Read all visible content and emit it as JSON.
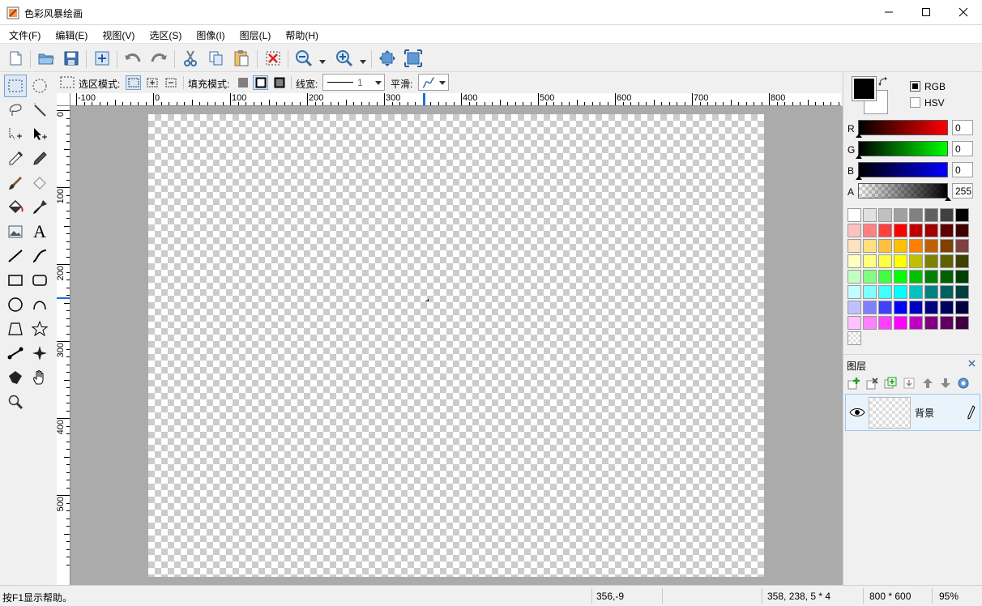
{
  "window": {
    "title": "色彩风暴绘画"
  },
  "menu": [
    "文件(F)",
    "编辑(E)",
    "视图(V)",
    "选区(S)",
    "图像(I)",
    "图层(L)",
    "帮助(H)"
  ],
  "toolbar": {
    "icons": [
      "new-file-icon",
      "open-folder-icon",
      "save-icon",
      "resize-canvas-icon",
      "undo-icon",
      "redo-icon",
      "cut-icon",
      "copy-icon",
      "paste-icon",
      "deselect-icon",
      "zoom-out-icon",
      "zoom-in-icon",
      "fit-window-icon",
      "actual-size-icon"
    ]
  },
  "options": {
    "select_mode_label": "选区模式:",
    "fill_mode_label": "填充模式:",
    "line_width_label": "线宽:",
    "line_width_value": "1",
    "smooth_label": "平滑:"
  },
  "rulers": {
    "horizontal": [
      "-100",
      "0",
      "100",
      "200",
      "300",
      "400",
      "500",
      "600",
      "700",
      "800"
    ],
    "vertical": [
      "0",
      "100",
      "200",
      "300",
      "400",
      "500"
    ]
  },
  "color": {
    "primary": "#000000",
    "secondary": "#ffffff",
    "mode_rgb": "RGB",
    "mode_hsv": "HSV",
    "r_label": "R",
    "r_value": "0",
    "g_label": "G",
    "g_value": "0",
    "b_label": "B",
    "b_value": "0",
    "a_label": "A",
    "a_value": "255",
    "palette": [
      [
        "#ffffff",
        "#e0e0e0",
        "#c0c0c0",
        "#a0a0a0",
        "#808080",
        "#606060",
        "#404040",
        "#000000"
      ],
      [
        "#ffc0c0",
        "#ff8080",
        "#ff4040",
        "#ff0000",
        "#c00000",
        "#a00000",
        "#600000",
        "#400000"
      ],
      [
        "#ffe0c0",
        "#ffe080",
        "#ffc040",
        "#ffc000",
        "#ff8000",
        "#c06000",
        "#804000",
        "#804040"
      ],
      [
        "#ffffc0",
        "#ffff80",
        "#ffff40",
        "#ffff00",
        "#c0c000",
        "#808000",
        "#606000",
        "#404000"
      ],
      [
        "#c0ffc0",
        "#80ff80",
        "#40ff40",
        "#00ff00",
        "#00c000",
        "#008000",
        "#006000",
        "#004000"
      ],
      [
        "#c0ffff",
        "#80ffff",
        "#40ffff",
        "#00ffff",
        "#00c0c0",
        "#008080",
        "#006060",
        "#004040"
      ],
      [
        "#c0c0ff",
        "#8080ff",
        "#4040ff",
        "#0000ff",
        "#0000c0",
        "#000080",
        "#000060",
        "#000040"
      ],
      [
        "#ffc0ff",
        "#ff80ff",
        "#ff40ff",
        "#ff00ff",
        "#c000c0",
        "#800080",
        "#600060",
        "#400040"
      ]
    ]
  },
  "layers": {
    "title": "图层",
    "items": [
      {
        "name": "背景"
      }
    ]
  },
  "status": {
    "help": "按F1显示帮助。",
    "cursor": "356,-9",
    "selection": "358, 238, 5 * 4",
    "size": "800 * 600",
    "zoom": "95%"
  }
}
